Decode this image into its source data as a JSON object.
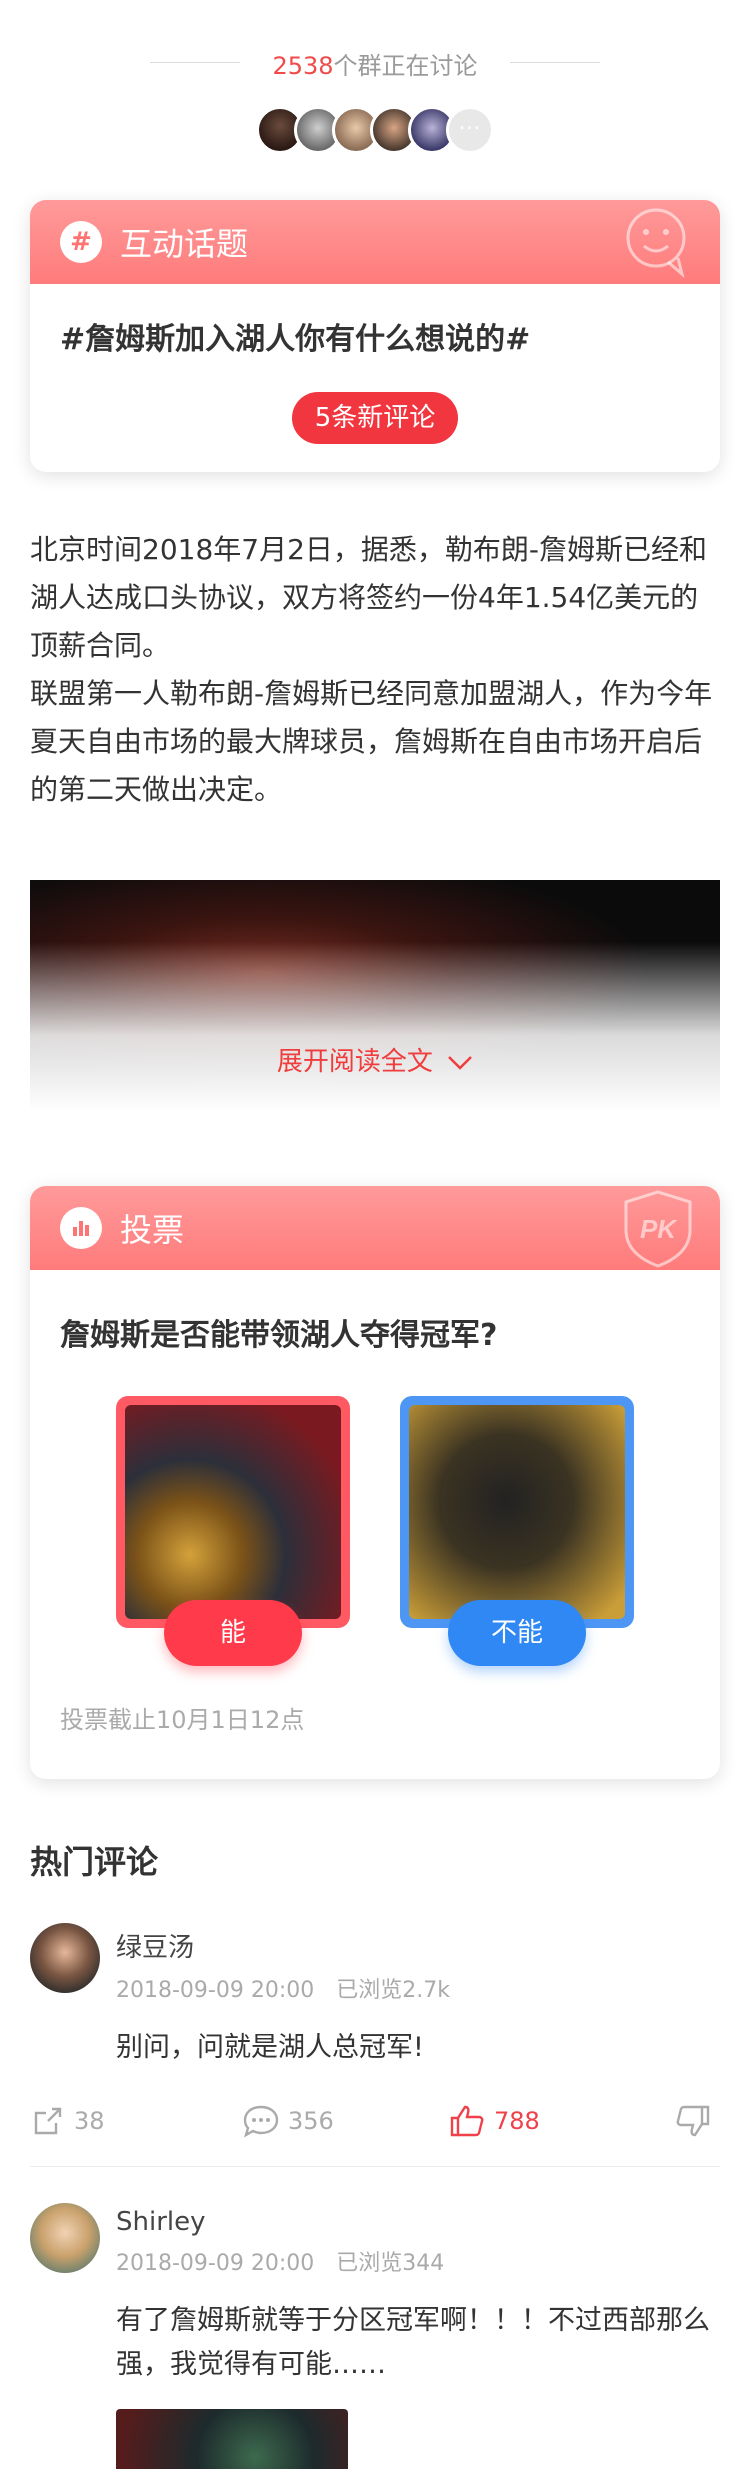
{
  "discussion": {
    "count": "2538",
    "suffix": "个群正在讨论",
    "more_label": "···"
  },
  "topic": {
    "header_label": "互动话题",
    "title": "#詹姆斯加入湖人你有什么想说的#",
    "new_comments": "5条新评论"
  },
  "article": {
    "paragraph_1": "北京时间2018年7月2日，据悉，勒布朗-詹姆斯已经和湖人达成口头协议，双方将签约一份4年1.54亿美元的顶薪合同。",
    "paragraph_2": "联盟第一人勒布朗-詹姆斯已经同意加盟湖人，作为今年夏天自由市场的最大牌球员，詹姆斯在自由市场开启后的第二天做出决定。",
    "expand_label": "展开阅读全文"
  },
  "vote": {
    "header_label": "投票",
    "badge": "PK",
    "question": "詹姆斯是否能带领湖人夺得冠军?",
    "option_yes": "能",
    "option_no": "不能",
    "deadline": "投票截止10月1日12点"
  },
  "hot_comments": {
    "title": "热门评论",
    "items": [
      {
        "name": "绿豆汤",
        "time": "2018-09-09 20:00",
        "views": "已浏览2.7k",
        "text": "别问，问就是湖人总冠军!",
        "shares": "38",
        "replies": "356",
        "likes": "788"
      },
      {
        "name": "Shirley",
        "time": "2018-09-09 20:00",
        "views": "已浏览344",
        "text": "有了詹姆斯就等于分区冠军啊！！！不过西部那么强，我觉得有可能……"
      }
    ]
  },
  "colors": {
    "accent_red": "#f2363f",
    "header_pink": "#ff8a8a",
    "vote_blue": "#2f88f3"
  }
}
